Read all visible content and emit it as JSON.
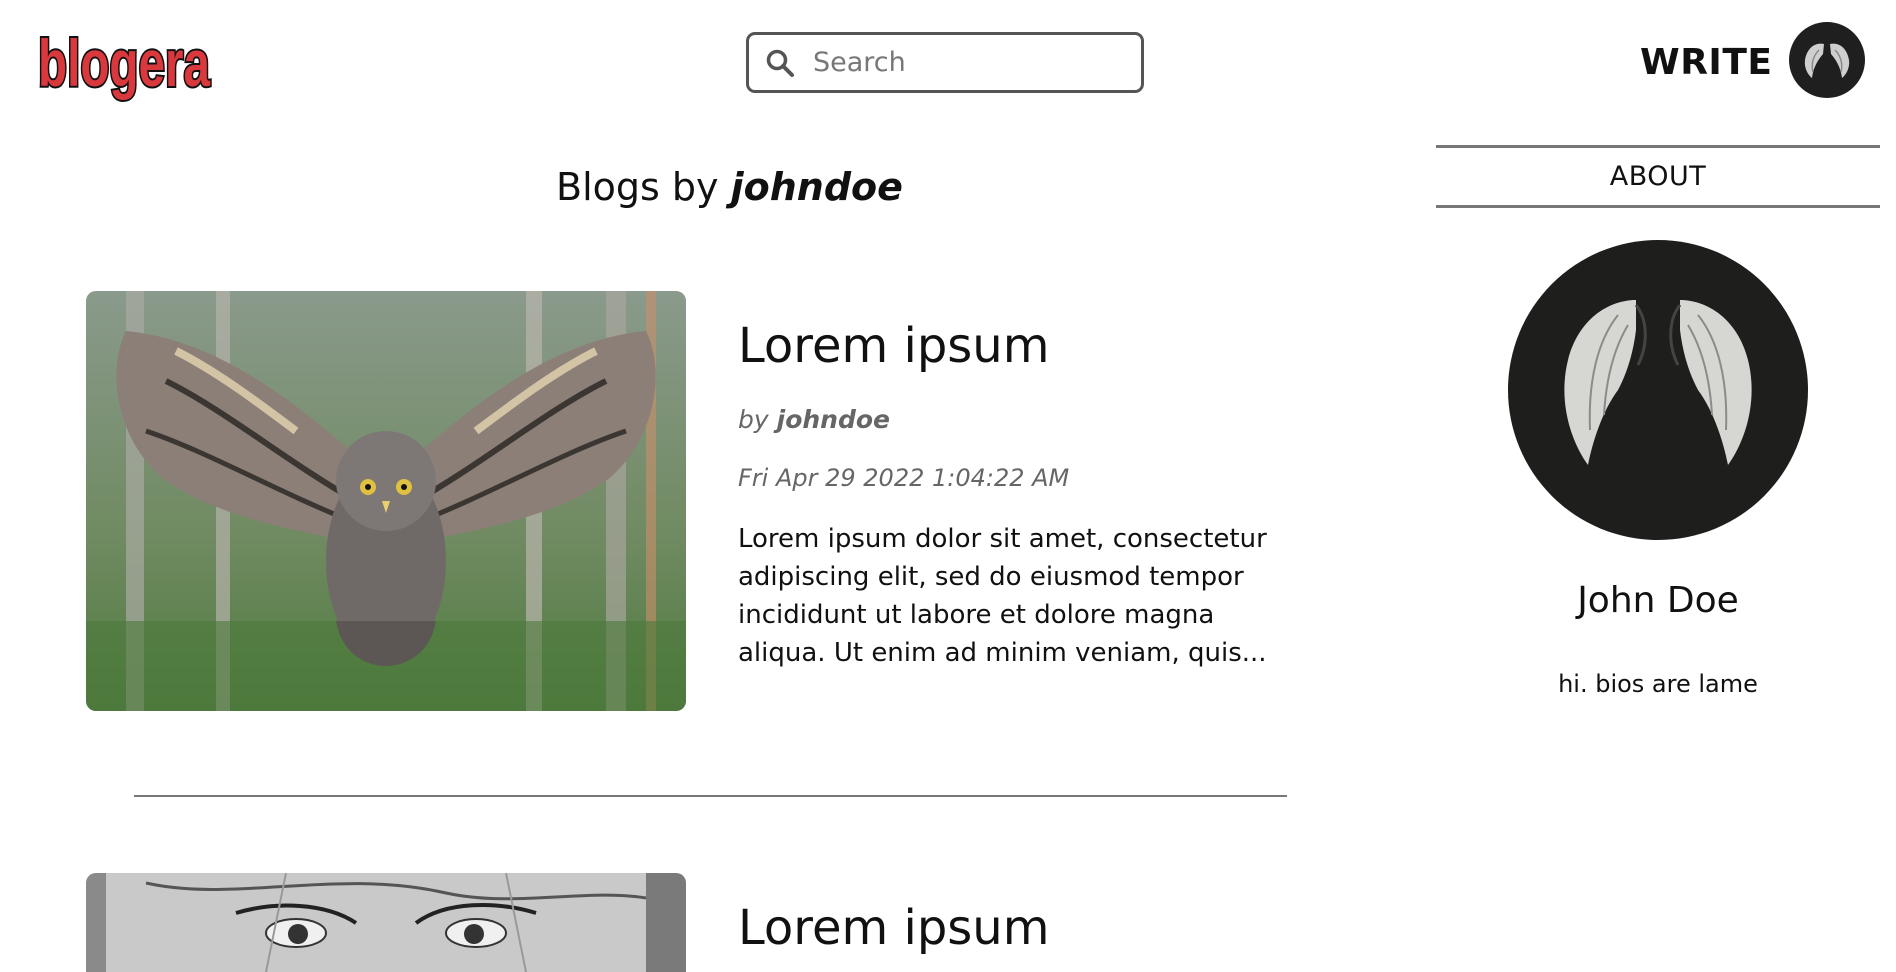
{
  "header": {
    "logo_text": "blogera",
    "search_placeholder": "Search",
    "write_label": "WRITE"
  },
  "page": {
    "title_prefix": "Blogs by",
    "title_user": "johndoe"
  },
  "posts": [
    {
      "title": "Lorem ipsum",
      "by_label": "by",
      "author": "johndoe",
      "date": "Fri Apr 29 2022 1:04:22 AM",
      "excerpt": "Lorem ipsum dolor sit amet, consectetur adipiscing elit, sed do eiusmod tempor incididunt ut labore et dolore magna aliqua. Ut enim ad minim veniam, quis..."
    },
    {
      "title": "Lorem ipsum"
    }
  ],
  "sidebar": {
    "about_label": "ABOUT",
    "name": "John Doe",
    "bio": "hi. bios are lame"
  },
  "colors": {
    "logo_red": "#d9383d",
    "divider": "#777777",
    "muted_text": "#666666"
  }
}
